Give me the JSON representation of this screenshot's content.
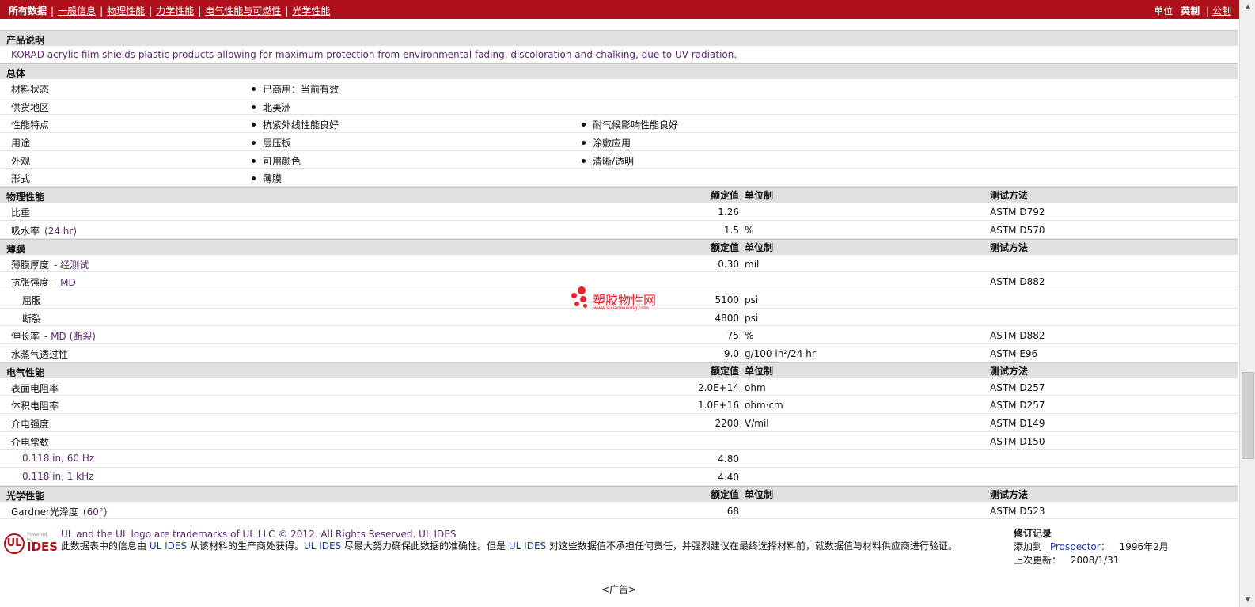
{
  "topbar": {
    "all_data": "所有数据",
    "links": [
      "一般信息",
      "物理性能",
      "力学性能",
      "电气性能与可燃性",
      "光学性能"
    ],
    "units_label": "单位",
    "units_active": "英制",
    "units_other": "公制"
  },
  "product": {
    "section_title": "产品说明",
    "description": "KORAD acrylic film shields plastic products allowing for maximum protection from environmental fading, discoloration and chalking, due to UV radiation."
  },
  "general": {
    "section_title": "总体",
    "rows": [
      {
        "label": "材料状态",
        "b1": "已商用：当前有效",
        "b2": ""
      },
      {
        "label": "供货地区",
        "b1": "北美洲",
        "b2": ""
      },
      {
        "label": "性能特点",
        "b1": "抗紫外线性能良好",
        "b2": "耐气候影响性能良好"
      },
      {
        "label": "用途",
        "b1": "层压板",
        "b2": "涂敷应用"
      },
      {
        "label": "外观",
        "b1": "可用颜色",
        "b2": "清晰/透明"
      },
      {
        "label": "形式",
        "b1": "薄膜",
        "b2": ""
      }
    ]
  },
  "headers": {
    "value": "额定值",
    "unit": "单位制",
    "method": "测试方法"
  },
  "physical": {
    "section_title": "物理性能",
    "rows": [
      {
        "label": "比重",
        "cond": "",
        "value": "1.26",
        "unit": "",
        "method": "ASTM D792"
      },
      {
        "label": "吸水率",
        "cond": "(24 hr)",
        "value": "1.5",
        "unit": "%",
        "method": "ASTM D570"
      }
    ]
  },
  "film": {
    "section_title": "薄膜",
    "rows": [
      {
        "label": "薄膜厚度",
        "cond": "- 经测试",
        "value": "0.30",
        "unit": "mil",
        "method": ""
      },
      {
        "label": "抗张强度",
        "cond": "- MD",
        "value": "",
        "unit": "",
        "method": "ASTM D882"
      },
      {
        "label": "屈服",
        "cond": "",
        "value": "5100",
        "unit": "psi",
        "method": ""
      },
      {
        "label": "断裂",
        "cond": "",
        "value": "4800",
        "unit": "psi",
        "method": ""
      },
      {
        "label": "伸长率",
        "cond": "- MD (断裂)",
        "value": "75",
        "unit": "%",
        "method": "ASTM D882"
      },
      {
        "label": "水蒸气透过性",
        "cond": "",
        "value": "9.0",
        "unit": "g/100 in²/24 hr",
        "method": "ASTM E96"
      }
    ]
  },
  "electrical": {
    "section_title": "电气性能",
    "rows": [
      {
        "label": "表面电阻率",
        "cond": "",
        "value": "2.0E+14",
        "unit": "ohm",
        "method": "ASTM D257"
      },
      {
        "label": "体积电阻率",
        "cond": "",
        "value": "1.0E+16",
        "unit": "ohm·cm",
        "method": "ASTM D257"
      },
      {
        "label": "介电强度",
        "cond": "",
        "value": "2200",
        "unit": "V/mil",
        "method": "ASTM D149"
      },
      {
        "label": "介电常数",
        "cond": "",
        "value": "",
        "unit": "",
        "method": "ASTM D150"
      },
      {
        "label": "0.118 in, 60 Hz",
        "cond": "",
        "value": "4.80",
        "unit": "",
        "method": ""
      },
      {
        "label": "0.118 in, 1 kHz",
        "cond": "",
        "value": "4.40",
        "unit": "",
        "method": ""
      }
    ]
  },
  "optical": {
    "section_title": "光学性能",
    "rows": [
      {
        "label": "Gardner光泽度",
        "cond": "(60°)",
        "value": "68",
        "unit": "",
        "method": "ASTM D523"
      }
    ]
  },
  "watermark": {
    "text": "塑胶物性网",
    "url": "www.sujiaowuxing.com"
  },
  "footer": {
    "logo_powered": "Powered by",
    "logo_ul": "UL",
    "logo_ides": "IDES",
    "line1": "UL and the UL logo are trademarks of UL LLC © 2012. All Rights Reserved. UL IDES",
    "line2_a": "此数据表中的信息由",
    "ul_ides_1": "UL IDES",
    "line2_b": "从该材料的生产商处获得。",
    "ul_ides_2": "UL IDES",
    "line2_c": "尽最大努力确保此数据的准确性。但是",
    "ul_ides_3": "UL IDES",
    "line2_d": "对这些数据值不承担任何责任，并强烈建议在最终选择材料前，就数据值与材料供应商进行验证。",
    "revision_title": "修订记录",
    "added_label": "添加到",
    "added_target": "Prospector：",
    "added_date": "1996年2月",
    "updated_label": "上次更新：",
    "updated_date": "2008/1/31",
    "ad": "<广告>"
  }
}
